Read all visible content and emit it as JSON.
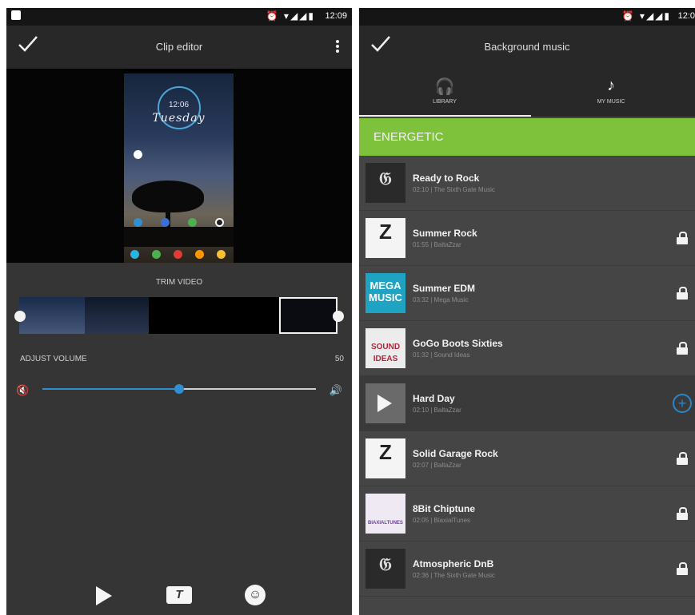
{
  "left": {
    "status_time": "12:09",
    "title": "Clip editor",
    "preview": {
      "clock": "12:06",
      "day": "Tuesday"
    },
    "trim_label": "TRIM VIDEO",
    "volume": {
      "label": "ADJUST VOLUME",
      "value": "50",
      "fraction": 0.5
    },
    "bottom_icons": [
      "play-icon",
      "text-icon",
      "emoji-icon"
    ],
    "text_icon_glyph": "T",
    "accent_color": "#2f8fd0"
  },
  "right": {
    "status_time": "12:0",
    "title": "Background music",
    "tabs": [
      {
        "label": "LIBRARY",
        "icon": "headphones-icon",
        "selected": true
      },
      {
        "label": "MY MUSIC",
        "icon": "music-note-icon",
        "selected": false
      }
    ],
    "category": "ENERGETIC",
    "category_color": "#7ec13b",
    "tracks": [
      {
        "name": "Ready to Rock",
        "meta": "02:10 | The Sixth Gate Music",
        "action": "none"
      },
      {
        "name": "Summer Rock",
        "meta": "01:55 | BaltaZzar",
        "action": "lock"
      },
      {
        "name": "Summer EDM",
        "meta": "03:32 | Mega Music",
        "action": "lock",
        "thumb_text": "MEGA MUSIC"
      },
      {
        "name": "GoGo Boots Sixties",
        "meta": "01:32 | Sound Ideas",
        "action": "lock",
        "thumb_text": "SOUND IDEAS"
      },
      {
        "name": "Hard Day",
        "meta": "02:10 | BaltaZzar",
        "action": "add",
        "selected": true
      },
      {
        "name": "Solid Garage Rock",
        "meta": "02:07 | BaltaZzar",
        "action": "lock"
      },
      {
        "name": "8Bit Chiptune",
        "meta": "02:05 | BiaxialTunes",
        "action": "lock",
        "thumb_text": "BIAXIALTUNES"
      },
      {
        "name": "Atmospheric DnB",
        "meta": "02:36 | The Sixth Gate Music",
        "action": "lock"
      }
    ]
  }
}
